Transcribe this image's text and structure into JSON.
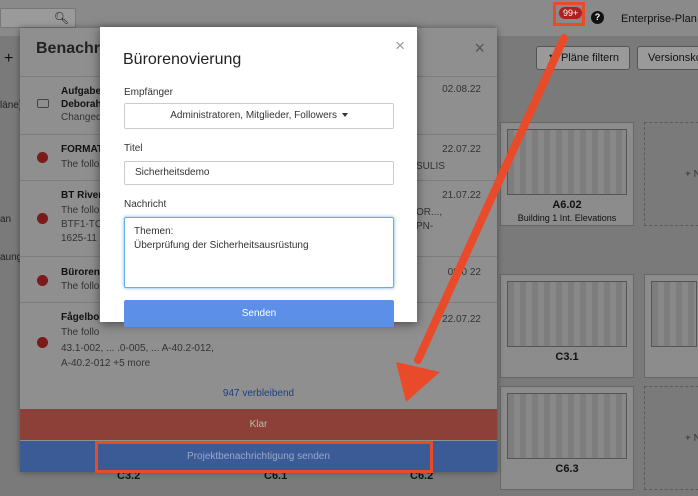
{
  "topbar": {
    "badge": "99+",
    "help": "?",
    "plan_label": "Enterprise-Plan"
  },
  "toolbar": {
    "filter_button": "Pläne filtern",
    "version_button": "Versionsko"
  },
  "background": {
    "side_labels": [
      "läne)",
      "an",
      "aung"
    ],
    "thumbs": [
      {
        "code": "A6.02",
        "subtitle": "Building 1 Int. Elevations"
      },
      {
        "code": "C3.1",
        "subtitle": ""
      },
      {
        "code": "C6.3",
        "subtitle": ""
      },
      {
        "code": "C3.2",
        "subtitle": ""
      },
      {
        "code": "C6.1",
        "subtitle": ""
      },
      {
        "code": "C6.2",
        "subtitle": ""
      }
    ],
    "add_label": "+ N"
  },
  "notifications": {
    "title": "Benachri",
    "items": [
      {
        "heading": "Aufgabe",
        "line1": "Deborah",
        "line2": "Changed",
        "date": "02.08.22",
        "icon": "chat-icon"
      },
      {
        "heading": "FORMAT",
        "line1": "The follo",
        "line2": "SULIS",
        "date": "22.07.22",
        "icon": "alert-icon"
      },
      {
        "heading": "BT River",
        "line1": "The follo",
        "line2": "BTF1-TC",
        "line3": "1625-11",
        "extra1": "OR...,",
        "extra2": "PN-",
        "date": "21.07.22",
        "icon": "alert-icon"
      },
      {
        "heading": "Büroren",
        "line1": "The follo",
        "date": "08.0 22",
        "icon": "alert-icon"
      },
      {
        "heading": "Fågelbo",
        "line1": "The follo",
        "line2": "43.1-002, ... .0-005, ... A-40.2-012,",
        "line3": "A-40.2-012 +5 more",
        "date": "22.07.22",
        "icon": "alert-icon"
      }
    ],
    "remaining": "947 verbleibend",
    "klar": "Klar",
    "send_project": "Projektbenachrichtigung senden"
  },
  "dialog": {
    "title": "Bürorenovierung",
    "recipients_label": "Empfänger",
    "recipients_value": "Administratoren, Mitglieder, Followers",
    "title_label": "Titel",
    "title_value": "Sicherheitsdemo",
    "message_label": "Nachricht",
    "message_value": "Themen:\nÜberprüfung der Sicherheitsausrüstung",
    "send_label": "Senden"
  },
  "colors": {
    "annotation": "#e84a2a",
    "send_button": "#5b8fe8"
  }
}
